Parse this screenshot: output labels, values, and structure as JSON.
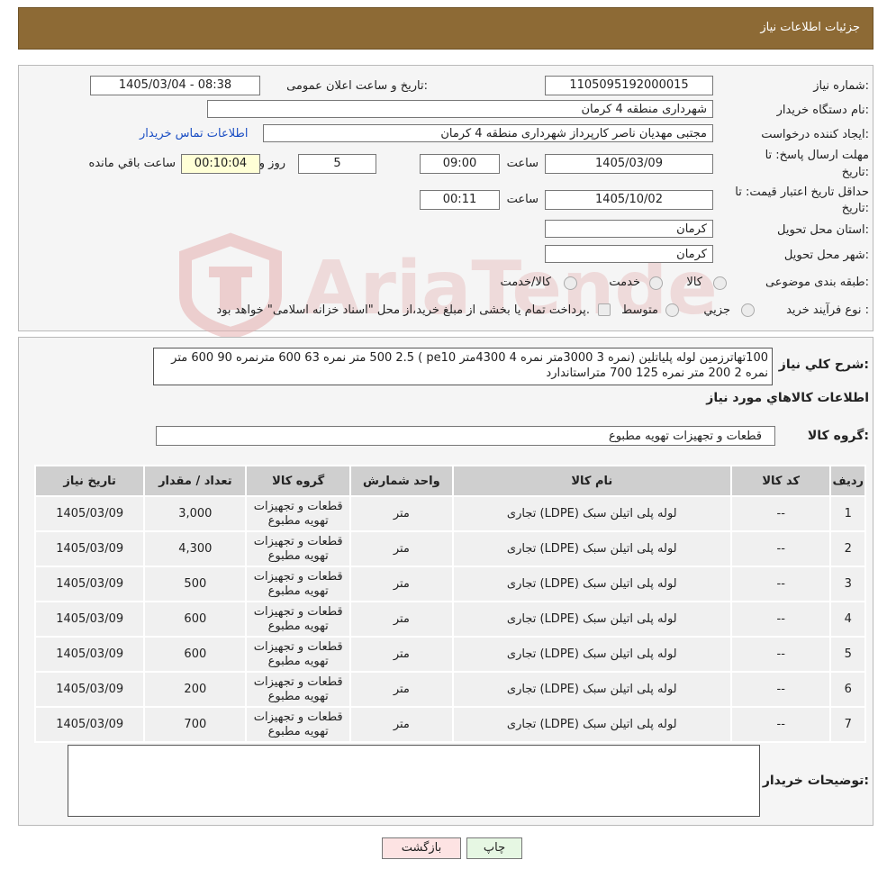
{
  "header": {
    "title": "جزئیات اطلاعات نیاز"
  },
  "form": {
    "need_number_label": "شماره نیاز:",
    "need_number": "1105095192000015",
    "announce_label": "تاریخ و ساعت اعلان عمومی:",
    "announce_value": "1405/03/04 - 08:38",
    "buyer_org_label": "نام دستگاه خریدار:",
    "buyer_org": "شهرداری منطقه 4 کرمان",
    "requester_label": "ایجاد کننده درخواست:",
    "requester": "مجتبی مهدیان ناصر کارپرداز شهرداری منطقه 4 کرمان",
    "contact_link": "اطلاعات تماس خریدار",
    "deadline_label_1": "مهلت ارسال پاسخ: تا",
    "deadline_label_2": "تاریخ:",
    "deadline_date": "1405/03/09",
    "time_label": "ساعت",
    "deadline_time": "09:00",
    "days_value": "5",
    "days_label": "روز و",
    "remaining_value": "00:10:04",
    "remaining_label": "ساعت باقي مانده",
    "validity_label_1": "حداقل تاریخ اعتبار قیمت: تا",
    "validity_label_2": "تاریخ:",
    "validity_date": "1405/10/02",
    "validity_time": "00:11",
    "province_label": "استان محل تحویل:",
    "province": "کرمان",
    "city_label": "شهر محل تحویل:",
    "city": "کرمان",
    "category_label": "طبقه بندی موضوعی:",
    "category_options": [
      "کالا",
      "خدمت",
      "کالا/خدمت"
    ],
    "process_label": "نوع فرآیند خرید :",
    "process_options": [
      "جزیي",
      "متوسط"
    ],
    "process_note": "پرداخت تمام یا بخشی از مبلغ خرید،از محل \"اسناد خزانه اسلامی\" خواهد بود."
  },
  "summary": {
    "label": "شرح کلي نياز:",
    "text": "100تهاترزمین لوله پلیاتلین (نمره 3 3000متر نمره 4 4300متر pe10 ) 500 2.5 متر نمره 63 600 مترنمره 90 600 متر نمره 2 200 متر نمره 125 700 متراستاندارد"
  },
  "goods": {
    "section_title": "اطلاعات کالاهاي مورد نياز",
    "group_label": "گروه کالا:",
    "group_value": "قطعات و تجهیزات تهویه مطبوع"
  },
  "table": {
    "headers": [
      "ردیف",
      "کد کالا",
      "نام کالا",
      "واحد شمارش",
      "گروه کالا",
      "تعداد / مقدار",
      "تاریخ نیاز"
    ],
    "rows": [
      [
        "1",
        "--",
        "لوله پلی اتیلن سبک (LDPE) تجاری",
        "متر",
        "قطعات و تجهیزات تهویه مطبوع",
        "3,000",
        "1405/03/09"
      ],
      [
        "2",
        "--",
        "لوله پلی اتیلن سبک (LDPE) تجاری",
        "متر",
        "قطعات و تجهیزات تهویه مطبوع",
        "4,300",
        "1405/03/09"
      ],
      [
        "3",
        "--",
        "لوله پلی اتیلن سبک (LDPE) تجاری",
        "متر",
        "قطعات و تجهیزات تهویه مطبوع",
        "500",
        "1405/03/09"
      ],
      [
        "4",
        "--",
        "لوله پلی اتیلن سبک (LDPE) تجاری",
        "متر",
        "قطعات و تجهیزات تهویه مطبوع",
        "600",
        "1405/03/09"
      ],
      [
        "5",
        "--",
        "لوله پلی اتیلن سبک (LDPE) تجاری",
        "متر",
        "قطعات و تجهیزات تهویه مطبوع",
        "600",
        "1405/03/09"
      ],
      [
        "6",
        "--",
        "لوله پلی اتیلن سبک (LDPE) تجاری",
        "متر",
        "قطعات و تجهیزات تهویه مطبوع",
        "200",
        "1405/03/09"
      ],
      [
        "7",
        "--",
        "لوله پلی اتیلن سبک (LDPE) تجاری",
        "متر",
        "قطعات و تجهیزات تهویه مطبوع",
        "700",
        "1405/03/09"
      ]
    ]
  },
  "buyer_notes": {
    "label": "توضیحات خریدار:",
    "value": ""
  },
  "buttons": {
    "print": "چاپ",
    "back": "بازگشت"
  },
  "watermark": {
    "text": "AriaTender.neT"
  },
  "colors": {
    "header_bg": "#8d6a35",
    "link": "#1c4fc4",
    "back_button_bg": "#fde3e3",
    "print_button_bg": "#e6f7e3"
  }
}
